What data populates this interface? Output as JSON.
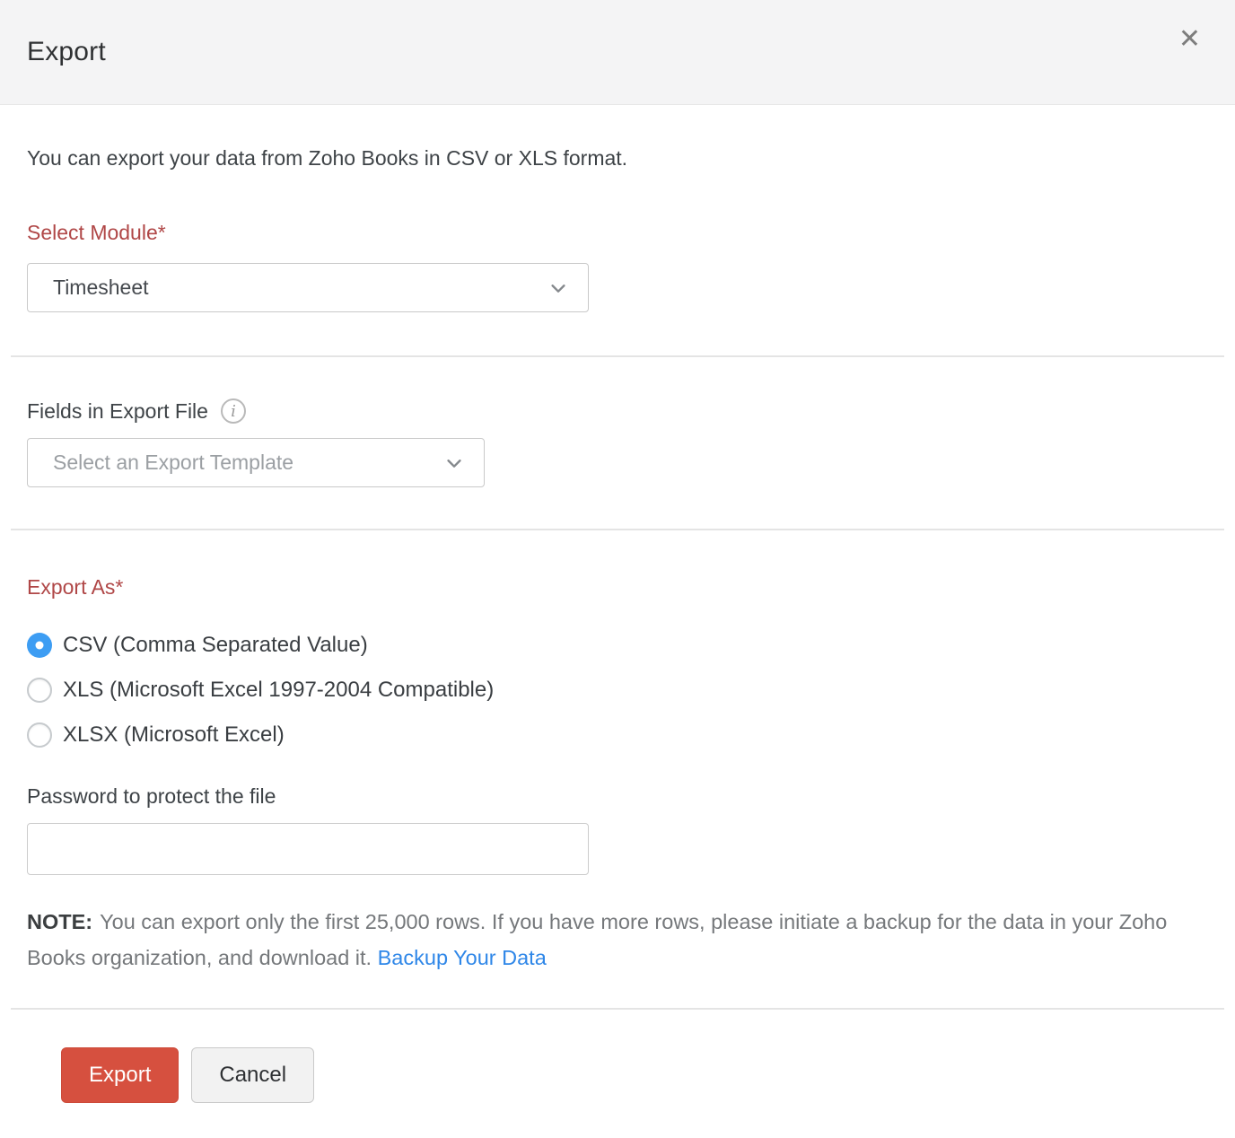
{
  "dialog": {
    "title": "Export",
    "close_icon": "✕"
  },
  "intro": "You can export your data from Zoho Books in CSV or XLS format.",
  "select_module": {
    "label": "Select Module*",
    "value": "Timesheet"
  },
  "fields_section": {
    "label": "Fields in Export File",
    "info_icon": "i",
    "placeholder": "Select an Export Template"
  },
  "export_as": {
    "label": "Export As*",
    "options": [
      {
        "label": "CSV (Comma Separated Value)",
        "selected": true
      },
      {
        "label": "XLS (Microsoft Excel 1997-2004 Compatible)",
        "selected": false
      },
      {
        "label": "XLSX (Microsoft Excel)",
        "selected": false
      }
    ]
  },
  "password": {
    "label": "Password to protect the file",
    "value": ""
  },
  "note": {
    "prefix": "NOTE:",
    "text": "You can export only the first 25,000 rows. If you have more rows, please initiate a backup for the data in your Zoho Books organization, and download it.",
    "link": "Backup Your Data"
  },
  "footer": {
    "export_label": "Export",
    "cancel_label": "Cancel"
  },
  "colors": {
    "header_bg": "#f4f4f5",
    "required_label_red": "#b04747",
    "export_button_red": "#d6503f",
    "radio_selected_blue": "#3d9df3",
    "link_blue": "#2f87e8"
  }
}
